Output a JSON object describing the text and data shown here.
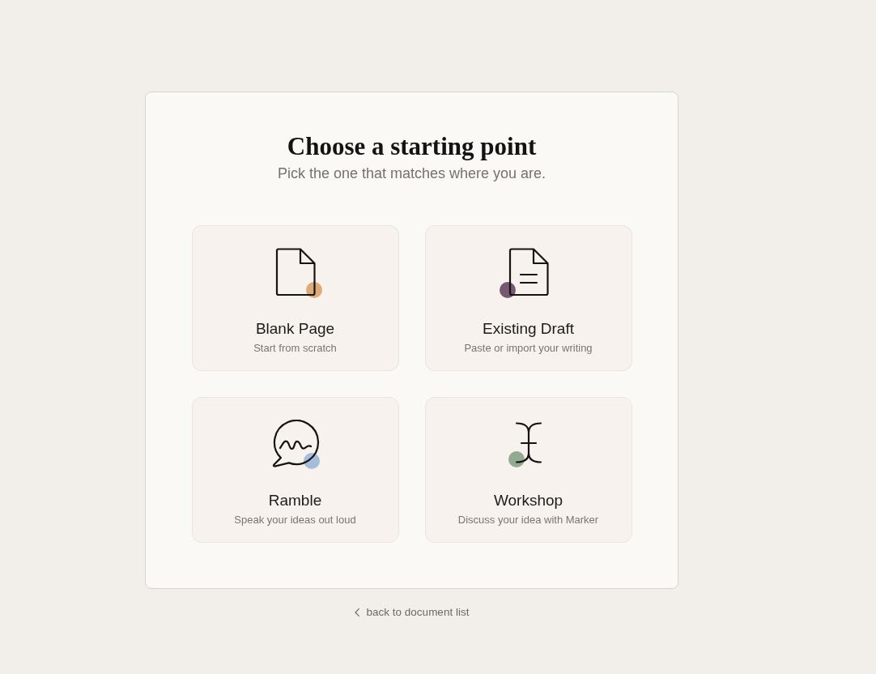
{
  "dialog": {
    "title": "Choose a starting point",
    "subtitle": "Pick the one that matches where you are."
  },
  "options": [
    {
      "kind": "page",
      "title": "Blank Page",
      "description": "Start from scratch",
      "color": "#dcab79"
    },
    {
      "kind": "draft",
      "title": "Existing Draft",
      "description": "Paste or import your writing",
      "color": "#76596f"
    },
    {
      "kind": "speech",
      "title": "Ramble",
      "description": "Speak your ideas out loud",
      "color": "#a5bddb"
    },
    {
      "kind": "cursor",
      "title": "Workshop",
      "description": "Discuss your idea with Marker",
      "color": "#92aa8f"
    }
  ],
  "back_link": {
    "label": "back to document list"
  }
}
